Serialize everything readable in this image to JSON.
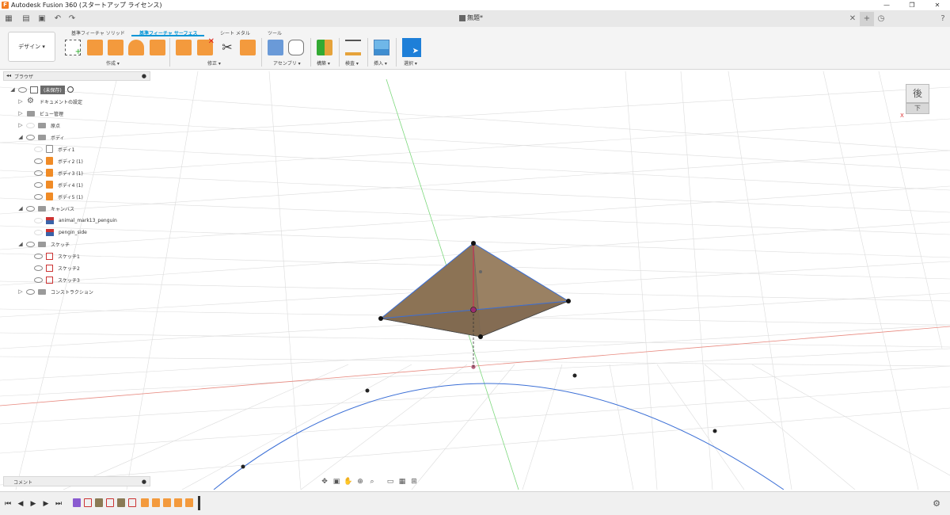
{
  "titlebar": {
    "title": "Autodesk Fusion 360 (スタートアップ ライセンス)",
    "app_icon": "F",
    "minimize": "—",
    "restore": "❐",
    "close": "✕"
  },
  "document_tab": {
    "name": "無題*",
    "close": "✕",
    "new_tab": "+"
  },
  "ribbon": {
    "workspace": "デザイン ▾",
    "tabs": [
      "基準フィーチャ ソリッド",
      "基準フィーチャ サーフェス",
      "シート メタル",
      "ツール"
    ],
    "active_tab": "基準フィーチャ サーフェス",
    "groups": [
      "作成 ▾",
      "修正 ▾",
      "アセンブリ ▾",
      "構築 ▾",
      "検査 ▾",
      "挿入 ▾",
      "選択 ▾"
    ]
  },
  "browser": {
    "title": "ブラウザ",
    "root": "(未保存)",
    "items": [
      "ドキュメントの設定",
      "ビュー管理",
      "原点",
      "ボディ",
      "ボディ1",
      "ボディ2 (1)",
      "ボディ3 (1)",
      "ボディ4 (1)",
      "ボディ5 (1)",
      "キャンバス",
      "animal_mark13_penguin",
      "pengin_side",
      "スケッチ",
      "スケッチ1",
      "スケッチ2",
      "スケッチ3",
      "コンストラクション"
    ]
  },
  "viewcube": {
    "face": "後",
    "bottom": "下",
    "axis_x": "X"
  },
  "comments": {
    "title": "コメント"
  },
  "colors": {
    "accent": "#0696d7",
    "body_fill": "#8c7355",
    "sketch_line": "#3b6fd6",
    "x_axis": "#e88a80",
    "y_axis": "#7dd87d",
    "feature_orange": "#f39a3d"
  }
}
